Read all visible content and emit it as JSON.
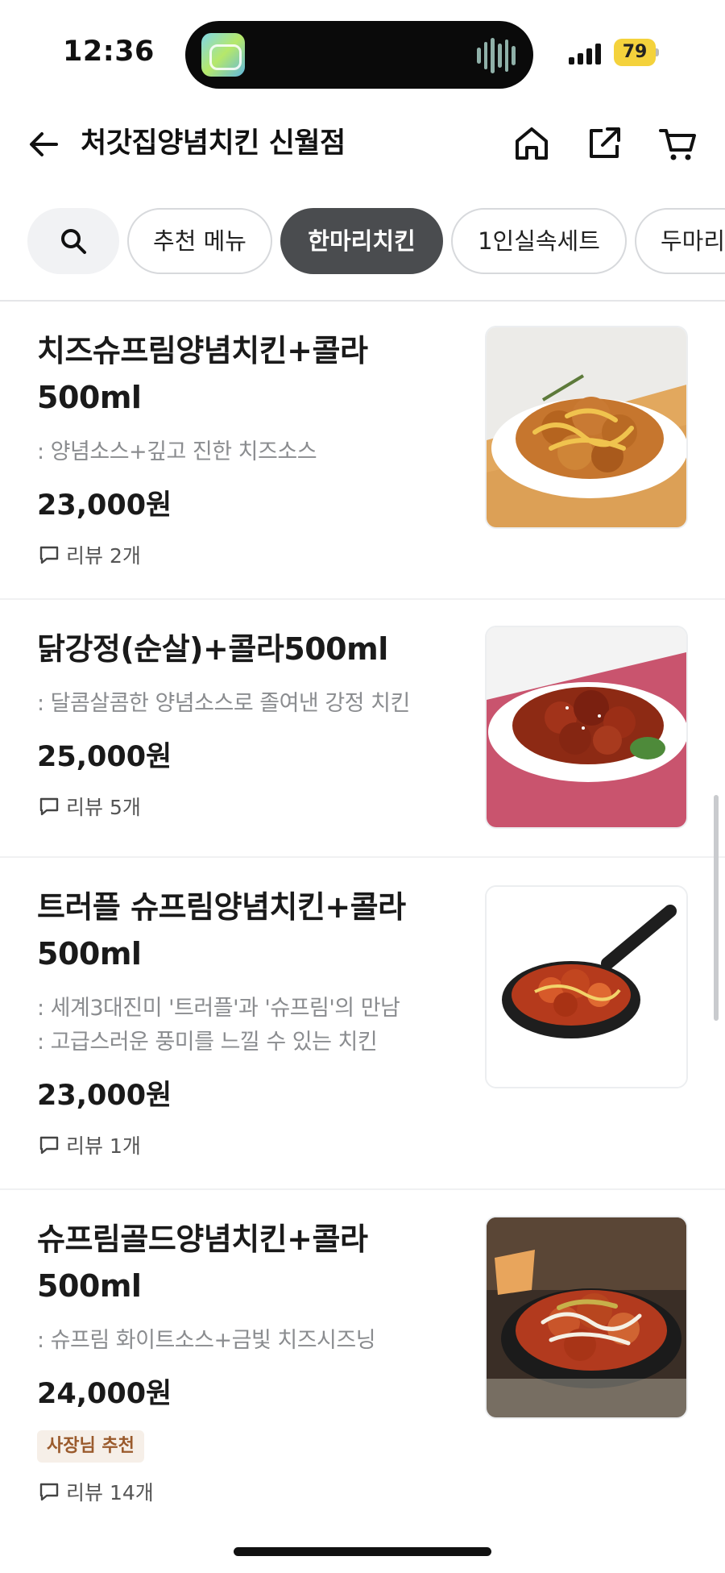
{
  "status_bar": {
    "time": "12:36",
    "battery": "79",
    "battery_color": "#f4d23c"
  },
  "header": {
    "title": "처갓집양념치킨 신월점",
    "icons": [
      "arrow-left-icon",
      "home-icon",
      "share-icon",
      "cart-icon"
    ]
  },
  "tabs": {
    "search_icon": "search-icon",
    "items": [
      {
        "label": "추천 메뉴",
        "active": false
      },
      {
        "label": "한마리치킨",
        "active": true
      },
      {
        "label": "1인실속세트",
        "active": false
      },
      {
        "label": "두마리",
        "active": false
      }
    ],
    "active_color": "#4a4c4f"
  },
  "menu": {
    "items": [
      {
        "name_line1": "치즈슈프림양념치킨+콜라",
        "name_line2": "500ml",
        "desc_line1": ": 양념소스+깊고 진한 치즈소스",
        "desc_line2": "",
        "price": "23,000원",
        "badge": "",
        "review": "리뷰 2개"
      },
      {
        "name_line1": "닭강정(순살)+콜라500ml",
        "name_line2": "",
        "desc_line1": ": 달콤살콤한 양념소스로 졸여낸 강정 치킨",
        "desc_line2": "",
        "price": "25,000원",
        "badge": "",
        "review": "리뷰 5개"
      },
      {
        "name_line1": "트러플 슈프림양념치킨+콜라",
        "name_line2": "500ml",
        "desc_line1": ": 세계3대진미 '트러플'과 '슈프림'의 만남",
        "desc_line2": ": 고급스러운 풍미를 느낄 수 있는 치킨",
        "price": "23,000원",
        "badge": "",
        "review": "리뷰 1개"
      },
      {
        "name_line1": "슈프림골드양념치킨+콜라",
        "name_line2": "500ml",
        "desc_line1": ": 슈프림 화이트소스+금빛 치즈시즈닝",
        "desc_line2": "",
        "price": "24,000원",
        "badge": "사장님 추천",
        "review": "리뷰 14개"
      }
    ]
  }
}
